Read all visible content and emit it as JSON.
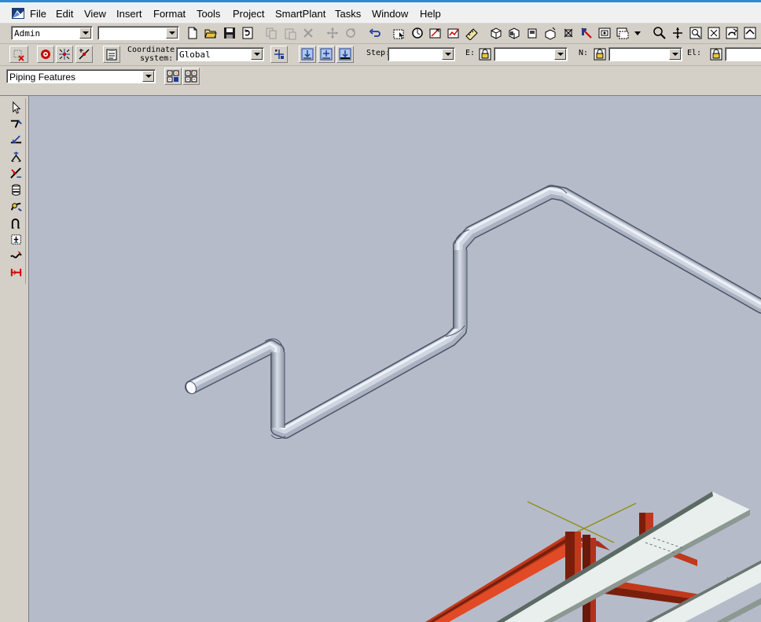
{
  "colors": {
    "viewport_bg": "#b5bbc9",
    "pipe": "#d0d6e2",
    "steel_red": "#c0391b",
    "slab_white": "#e9efec",
    "axis_olive": "#8f8f12"
  },
  "menu": [
    "File",
    "Edit",
    "View",
    "Insert",
    "Format",
    "Tools",
    "Project",
    "SmartPlant",
    "Tasks",
    "Window",
    "Help"
  ],
  "toolbar1": {
    "permission_group": "Admin",
    "filter_combo": "",
    "icons": [
      "new-icon",
      "open-icon",
      "save-icon",
      "refresh-icon",
      "copy-icon",
      "paste-icon",
      "delete-icon",
      "move-icon",
      "rotate-icon",
      "undo-icon",
      "select-by-filter-icon",
      "clip-icon",
      "measure-icon",
      "inspect-icon",
      "ruler-icon",
      "view-3d-icon",
      "view-front-icon",
      "view-top-icon",
      "view-side-icon",
      "zoom-area-icon",
      "perspective-icon",
      "common-views-icon",
      "named-views-icon",
      "dropdown-icon",
      "zoom-icon",
      "pan-icon",
      "zoom-tool-icon",
      "fit-icon",
      "rotate-view-icon",
      "home-icon"
    ]
  },
  "toolbar2": {
    "coordinate_label_line1": "Coordinate",
    "coordinate_label_line2": "system:",
    "coordinate_system": "Global",
    "step_label": "Step:",
    "step_value": "",
    "e_label": "E:",
    "e_value": "",
    "n_label": "N:",
    "n_value": "",
    "el_label": "El:",
    "el_value": ""
  },
  "toolbar3": {
    "task_mode": "Piping Features"
  },
  "leftbar_tools": [
    "select-tool-icon",
    "route-pipe-icon",
    "insert-component-icon",
    "insert-split-icon",
    "insert-tap-icon",
    "insert-specialty-icon",
    "insert-turn-icon",
    "route-bend-icon",
    "insert-instrument-icon",
    "tube-route-icon",
    "insert-spacer-icon"
  ]
}
